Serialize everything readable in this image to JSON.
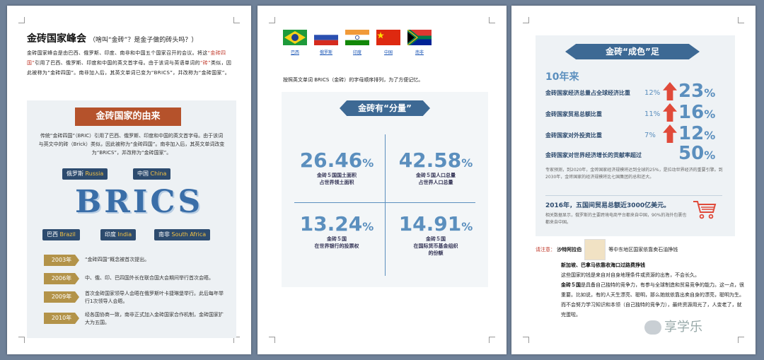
{
  "page1": {
    "title": "金砖国家峰会",
    "subtitle": "（啥叫“金砖”？是金子做的砖头吗？）",
    "para_a": "金砖国家峰会是由巴西、俄罗斯、印度、南非和中国五个国家召开的会议。将这",
    "para_hl1": "“金砖四国”",
    "para_b": "引用了巴西、俄罗斯、印度和中国的英文首字母。由于该词与英语单词的",
    "para_hl2": "“砖”",
    "para_c": "类似，因此被称为“金砖四国”。南非加入后，其英文单词已变为“BRICS”，并改称为“金砖国家”。",
    "banner": "金砖国家的由来",
    "info_para": "传统“金砖四国”（BRIC）引用了巴西、俄罗斯、印度和中国的英文首字母。由于该词与英文中的砖（Brick）类似，因此被称为“金砖四国”。南非加入后，其英文单词改变为“BRICS”，并改称为“金砖国家”。",
    "countries": [
      {
        "zh": "俄罗斯",
        "en": "Russia"
      },
      {
        "zh": "中国",
        "en": "China"
      },
      {
        "zh": "巴西",
        "en": "Brazil"
      },
      {
        "zh": "印度",
        "en": "India"
      },
      {
        "zh": "南非",
        "en": "South Africa"
      }
    ],
    "brics_word": "BRICS",
    "timeline": [
      {
        "year": "2003年",
        "text": "“金砖四国”概念被首次提出。"
      },
      {
        "year": "2006年",
        "text": "中、俄、印、巴四国外长在联合国大会期间举行首次会晤。"
      },
      {
        "year": "2009年",
        "text": "首次金砖国家领导人会晤在俄罗斯叶卡捷琳堡举行。此后每年举行1次领导人会晤。"
      },
      {
        "year": "2010年",
        "text": "经各国协商一致，南非正式加入金砖国家合作机制，金砖国家扩大为五国。"
      }
    ]
  },
  "page2": {
    "flags": [
      {
        "label": "巴西",
        "colors": [
          "#1e9a3a",
          "#f7d117",
          "#1f3f8f"
        ]
      },
      {
        "label": "俄罗斯",
        "colors": [
          "#ffffff",
          "#2a4fb0",
          "#d52b1e"
        ]
      },
      {
        "label": "印度",
        "colors": [
          "#f19a38",
          "#ffffff",
          "#138808"
        ]
      },
      {
        "label": "中国",
        "colors": [
          "#de2910",
          "#ffde00"
        ]
      },
      {
        "label": "南非",
        "colors": [
          "#007a4d",
          "#ffb612",
          "#de3831",
          "#002395"
        ]
      }
    ],
    "note": "按照英文单词 BRICS（金砖）的字母顺序排列，为了方便记忆。",
    "banner": "金砖有“分量”",
    "stats": [
      {
        "num": "26.46",
        "pct": "%",
        "l1": "金砖５国国土面积",
        "l2": "占世界领土面积"
      },
      {
        "num": "42.58",
        "pct": "%",
        "l1": "金砖５国人口总量",
        "l2": "占世界人口总量"
      },
      {
        "num": "13.24",
        "pct": "%",
        "l1": "金砖５国",
        "l2": "在世界银行的投票权"
      },
      {
        "num": "14.91",
        "pct": "%",
        "l1": "金砖５国",
        "l2": "在国际货币基金组织",
        "l3": "的份额"
      }
    ]
  },
  "page3": {
    "banner": "金砖“成色”足",
    "decade": "10年来",
    "rows": [
      {
        "label": "金砖国家经济总量占全球经济比重",
        "from": "12%",
        "to": "23",
        "pct": "%"
      },
      {
        "label": "金砖国家贸易总额比重",
        "from": "11%",
        "to": "16",
        "pct": "%"
      },
      {
        "label": "金砖国家对外投资比重",
        "from": "7%",
        "to": "12",
        "pct": "%"
      },
      {
        "label": "金砖国家对世界经济增长的贡献率超过",
        "from": "",
        "to": "50",
        "pct": "%"
      }
    ],
    "forecast": "专家预测，到2020年，金砖国家经济规模将达到全球的25%，是拉动世界经济的重要引擎。到2030年，金砖国家的经济规模将比七国集团的总和还大。",
    "trade_hl": "2016年，五国间贸易总额近3000亿美元。",
    "trade_sm": "相关数据显示，俄罗斯的主要跨境电商平台都来自中国，90%的海外包裹也都来自中国。",
    "note_label": "请注意：",
    "note_name": "沙特阿拉伯",
    "note_1": "等中东地区国家依靠卖石油挣钱",
    "note_2": "新加坡、巴拿马依靠收海口过路费挣钱",
    "note_3": "这些国家的钱是来自对自身地理条件或资源的出售，不会长久。",
    "note_4a": "金砖５国",
    "note_4b": "是具备自己独特的竞争力，有参与全球制造和贸易竞争的能力。这一点，很重要。比如说，有的人天生漂亮、聪明，那么她就依靠出卖自身的漂亮，聪明为生。而不会努力学习知识和本领（自己独特的竞争力），最终资源用光了，人变老了，就完蛋啦。",
    "watermark": "享学乐"
  }
}
